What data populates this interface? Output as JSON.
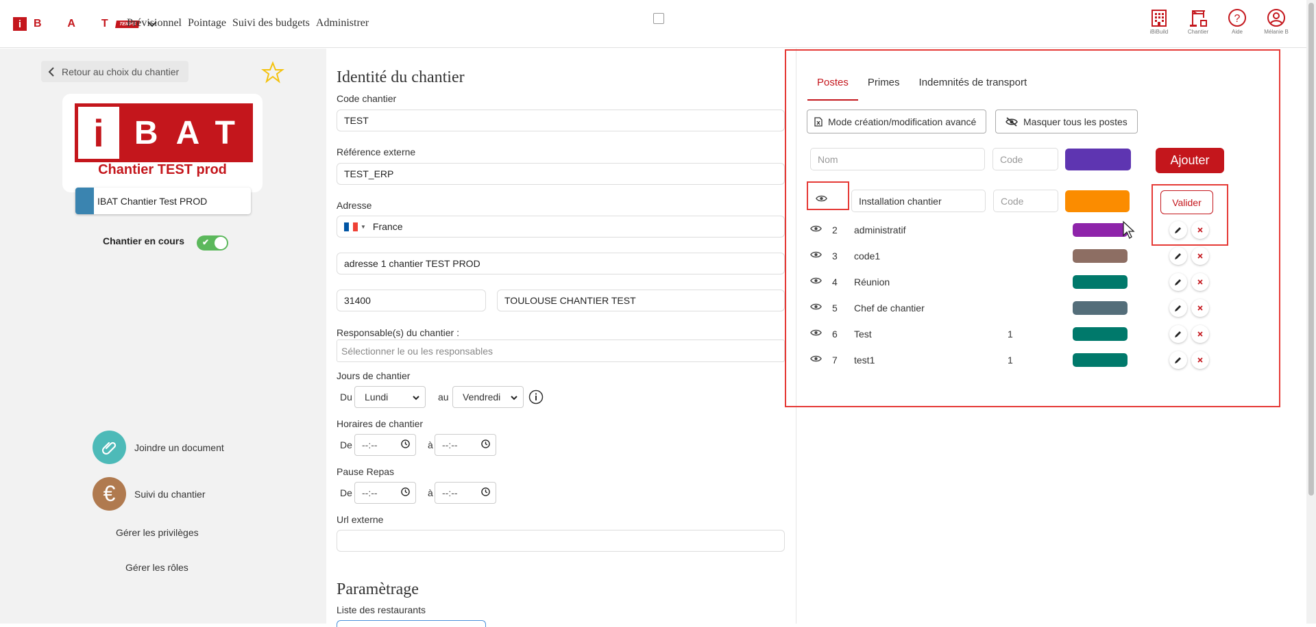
{
  "header": {
    "logo": {
      "i": "i",
      "letters": "B A T",
      "badge": "TEMPS"
    },
    "nav": [
      "Prévisionnel",
      "Pointage",
      "Suivi des budgets",
      "Administrer"
    ],
    "icons": [
      {
        "icon": "building-icon",
        "label": "iBiBuild"
      },
      {
        "icon": "crane-icon",
        "label": "Chantier"
      },
      {
        "icon": "help-icon",
        "label": "Aide"
      },
      {
        "icon": "user-icon",
        "label": "Mélanie B"
      }
    ]
  },
  "left": {
    "back_label": "Retour au choix du chantier",
    "logo_main_i": "i",
    "logo_main_bat": "BAT",
    "logo_caption": "Chantier TEST prod",
    "chantier_name": "IBAT Chantier Test PROD",
    "status_label": "Chantier en cours",
    "status_on": true,
    "attach_label": "Joindre un document",
    "suivi_label": "Suivi du chantier",
    "privileges_label": "Gérer les privilèges",
    "roles_label": "Gérer les rôles",
    "colors": {
      "attach": "#4dbab8",
      "suivi": "#b07a4f",
      "chip": "#3a84b0"
    }
  },
  "form": {
    "title": "Identité du chantier",
    "code_label": "Code chantier",
    "code_value": "TEST",
    "ref_label": "Référence externe",
    "ref_value": "TEST_ERP",
    "address_label": "Adresse",
    "country": "France",
    "address_line": "adresse 1 chantier TEST PROD",
    "postal": "31400",
    "city": "TOULOUSE CHANTIER TEST",
    "resp_label": "Responsable(s) du chantier :",
    "resp_placeholder": "Sélectionner le ou les responsables",
    "days_label": "Jours de chantier",
    "from_label": "Du",
    "from_value": "Lundi",
    "to_label": "au",
    "to_value": "Vendredi",
    "hours_label": "Horaires de chantier",
    "de_label": "De",
    "a_label": "à",
    "time_placeholder": "--:--",
    "pause_label": "Pause Repas",
    "url_label": "Url externe",
    "url_value": "",
    "param_title": "Paramètrage",
    "restaurants_label": "Liste des restaurants"
  },
  "postes": {
    "tabs": [
      "Postes",
      "Primes",
      "Indemnités de transport"
    ],
    "active_tab": "Postes",
    "mode_btn": "Mode création/modification avancé",
    "hide_btn": "Masquer tous les postes",
    "new": {
      "name_placeholder": "Nom",
      "code_placeholder": "Code",
      "color": "#5e35b1",
      "add_label": "Ajouter"
    },
    "editing": {
      "name": "Installation chantier",
      "code_placeholder": "Code",
      "color": "#fb8c00",
      "validate_label": "Valider"
    },
    "rows": [
      {
        "num": "2",
        "name": "administratif",
        "code": "",
        "color": "#8e24aa"
      },
      {
        "num": "3",
        "name": "code1",
        "code": "",
        "color": "#8d6e63"
      },
      {
        "num": "4",
        "name": "Réunion",
        "code": "",
        "color": "#00796b"
      },
      {
        "num": "5",
        "name": "Chef de chantier",
        "code": "",
        "color": "#546e7a"
      },
      {
        "num": "6",
        "name": "Test",
        "code": "1",
        "color": "#00796b"
      },
      {
        "num": "7",
        "name": "test1",
        "code": "1",
        "color": "#00796b"
      }
    ]
  }
}
